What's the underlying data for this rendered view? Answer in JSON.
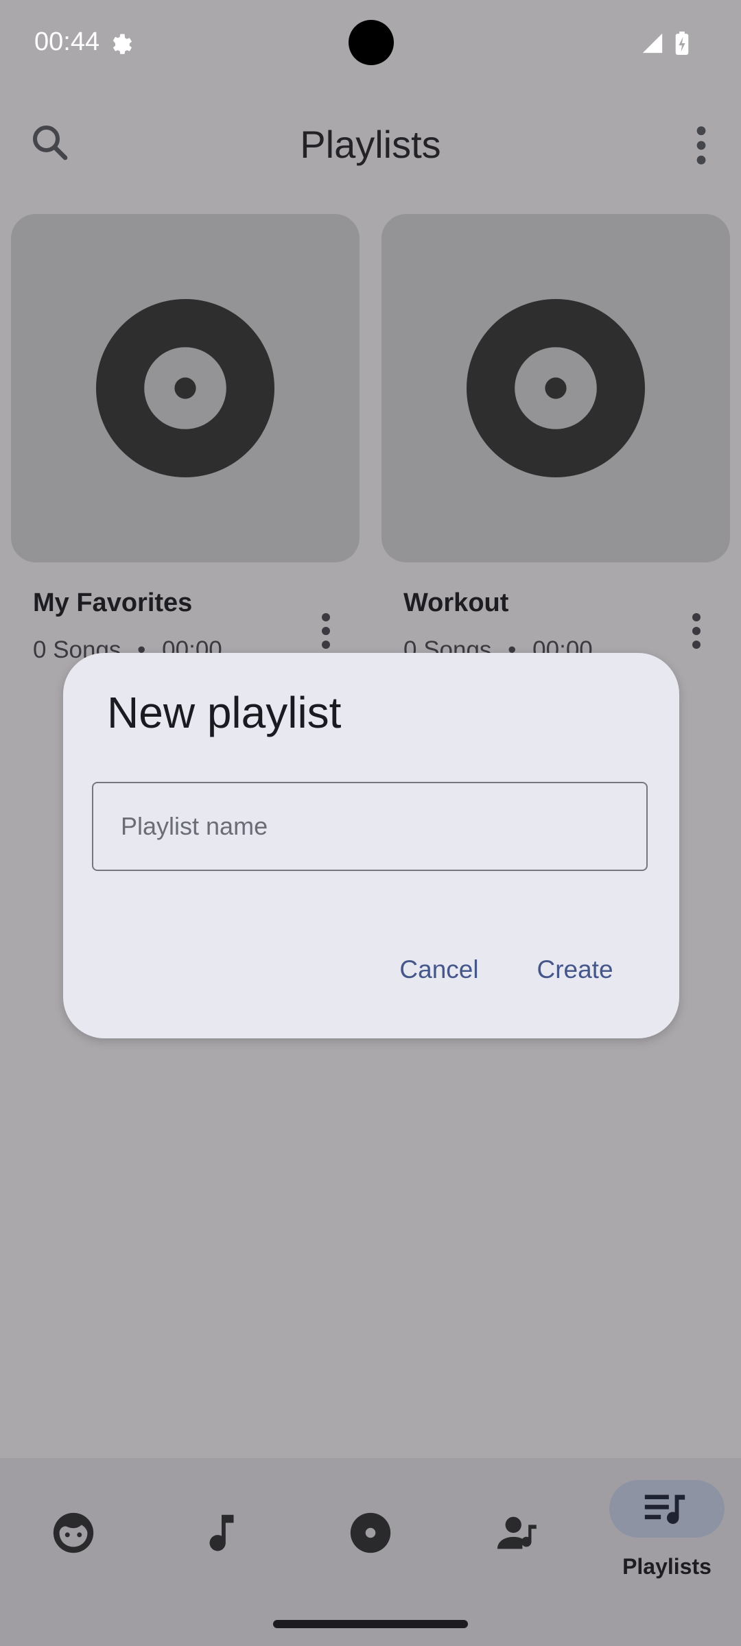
{
  "status_bar": {
    "time": "00:44"
  },
  "app_bar": {
    "title": "Playlists"
  },
  "playlists": [
    {
      "title": "My Favorites",
      "songs": "0 Songs",
      "separator": "•",
      "duration": "00:00"
    },
    {
      "title": "Workout",
      "songs": "0 Songs",
      "separator": "•",
      "duration": "00:00"
    }
  ],
  "bottom_nav": {
    "items": [
      {
        "icon": "face-icon",
        "label": ""
      },
      {
        "icon": "music-note-icon",
        "label": ""
      },
      {
        "icon": "album-icon",
        "label": ""
      },
      {
        "icon": "artist-icon",
        "label": ""
      },
      {
        "icon": "playlist-icon",
        "label": "Playlists",
        "selected": true
      }
    ]
  },
  "dialog": {
    "title": "New playlist",
    "input": {
      "placeholder": "Playlist name",
      "value": ""
    },
    "cancel_label": "Cancel",
    "create_label": "Create"
  },
  "colors": {
    "scrim_background": "#aaa8ab",
    "dialog_background": "#e8e8f1",
    "accent": "#45568b"
  }
}
